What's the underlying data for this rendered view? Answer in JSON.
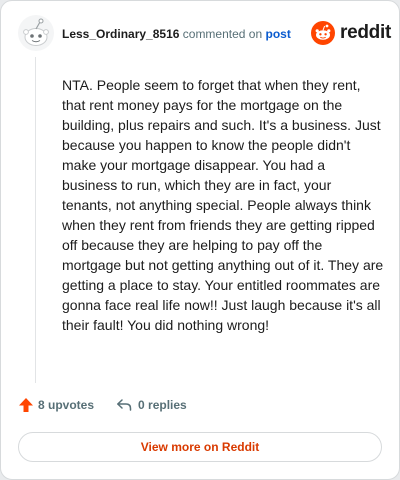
{
  "comment": {
    "username": "Less_Ordinary_8516",
    "action_text": "commented on",
    "post_label": "post",
    "body": "NTA. People seem to forget that when they rent, that rent money pays for the mortgage on the building, plus repairs and such. It's a business. Just because you happen to know the people didn't make your mortgage disappear. You had a business to run, which they are in fact, your tenants, not anything special. People always think when they rent from friends they are getting ripped off because they are helping to pay off the mortgage but not getting anything out of it. They are getting a place to stay. Your entitled roommates are gonna face real life now!! Just laugh because it's all their fault! You did nothing wrong!"
  },
  "brand": {
    "name": "reddit",
    "color": "#ff4500"
  },
  "stats": {
    "upvotes": "8 upvotes",
    "replies": "0 replies"
  },
  "footer": {
    "view_more": "View more on Reddit"
  },
  "icons": {
    "avatar": "snoo-avatar-icon",
    "logo": "reddit-snoo-icon",
    "upvote": "upvote-arrow-icon",
    "reply": "reply-arrow-icon"
  },
  "colors": {
    "accent": "#d93a00",
    "link": "#0a5bcf",
    "muted": "#576f76"
  }
}
